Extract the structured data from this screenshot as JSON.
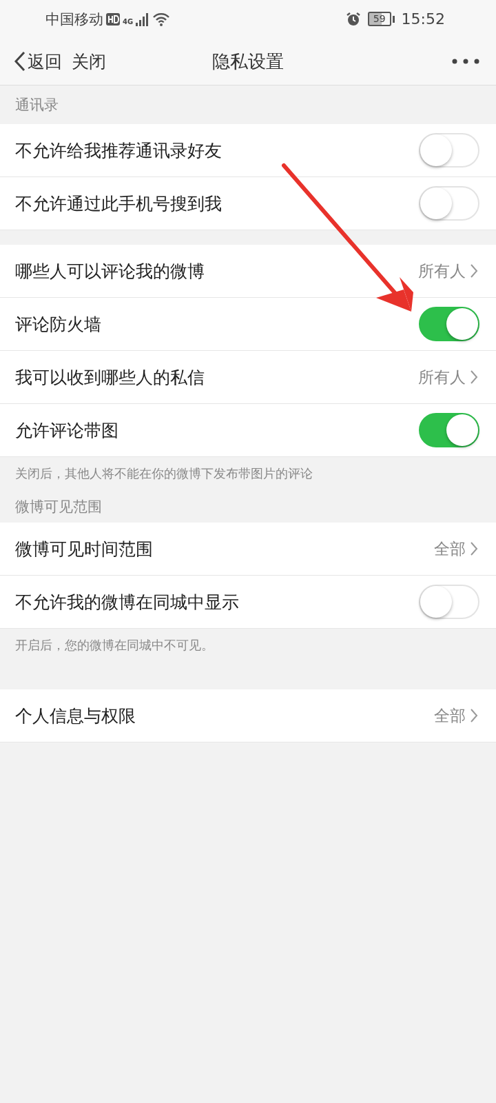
{
  "status_bar": {
    "carrier": "中国移动",
    "network": "4G",
    "battery": "59",
    "time": "15:52"
  },
  "nav_bar": {
    "back": "返回",
    "close": "关闭",
    "title": "隐私设置"
  },
  "sections": [
    {
      "header": "通讯录",
      "items": [
        {
          "kind": "toggle",
          "label": "不允许给我推荐通讯录好友",
          "on": false
        },
        {
          "kind": "toggle",
          "label": "不允许通过此手机号搜到我",
          "on": false
        }
      ]
    },
    {
      "items": [
        {
          "kind": "link",
          "label": "哪些人可以评论我的微博",
          "value": "所有人"
        },
        {
          "kind": "toggle",
          "label": "评论防火墙",
          "on": true
        },
        {
          "kind": "link",
          "label": "我可以收到哪些人的私信",
          "value": "所有人"
        },
        {
          "kind": "toggle",
          "label": "允许评论带图",
          "on": true
        }
      ],
      "note": "关闭后，其他人将不能在你的微博下发布带图片的评论"
    },
    {
      "header": "微博可见范围",
      "items": [
        {
          "kind": "link",
          "label": "微博可见时间范围",
          "value": "全部"
        },
        {
          "kind": "toggle",
          "label": "不允许我的微博在同城中显示",
          "on": false
        }
      ],
      "note": "开启后，您的微博在同城中不可见。"
    },
    {
      "items": [
        {
          "kind": "link",
          "label": "个人信息与权限",
          "value": "全部"
        }
      ]
    }
  ]
}
